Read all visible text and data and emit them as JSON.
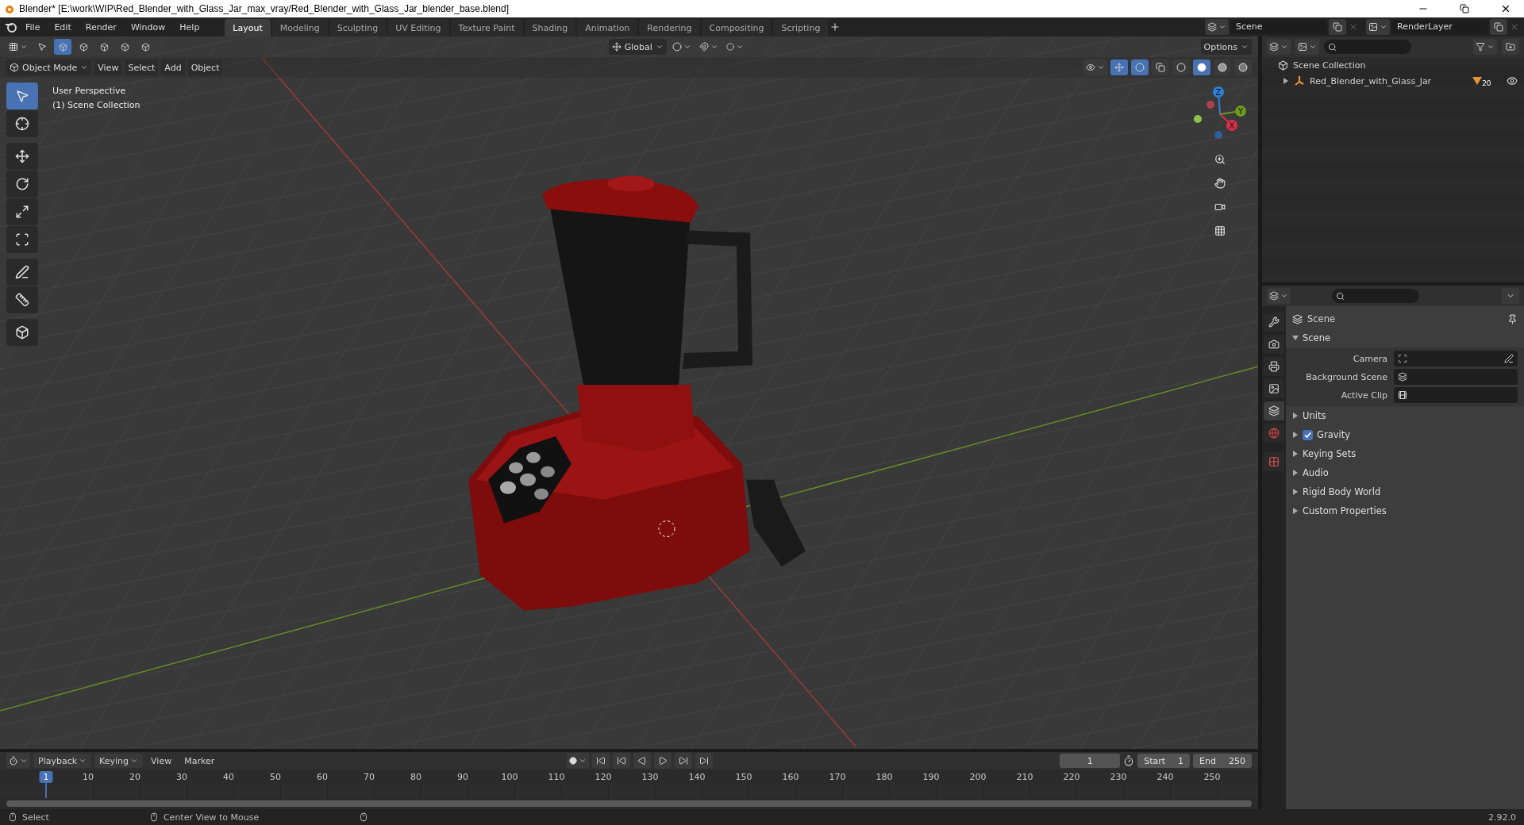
{
  "window": {
    "title": "Blender* [E:\\work\\WIP\\Red_Blender_with_Glass_Jar_max_vray/Red_Blender_with_Glass_Jar_blender_base.blend]"
  },
  "menu": [
    "File",
    "Edit",
    "Render",
    "Window",
    "Help"
  ],
  "workspaces": [
    {
      "label": "Layout",
      "selected": true
    },
    {
      "label": "Modeling",
      "selected": false
    },
    {
      "label": "Sculpting",
      "selected": false
    },
    {
      "label": "UV Editing",
      "selected": false
    },
    {
      "label": "Texture Paint",
      "selected": false
    },
    {
      "label": "Shading",
      "selected": false
    },
    {
      "label": "Animation",
      "selected": false
    },
    {
      "label": "Rendering",
      "selected": false
    },
    {
      "label": "Compositing",
      "selected": false
    },
    {
      "label": "Scripting",
      "selected": false
    }
  ],
  "scene_selector": {
    "value": "Scene"
  },
  "view_layer": {
    "value": "RenderLayer"
  },
  "viewport": {
    "select_modes": [
      {
        "selected": true
      },
      {
        "selected": false
      },
      {
        "selected": false
      },
      {
        "selected": false
      },
      {
        "selected": false
      }
    ],
    "orientation": "Global",
    "options": "Options",
    "mode": "Object Mode",
    "menus": [
      "View",
      "Select",
      "Add",
      "Object"
    ],
    "shading_modes": [
      {
        "kind": "wireframe",
        "selected": false
      },
      {
        "kind": "solid",
        "selected": true
      },
      {
        "kind": "material",
        "selected": false
      },
      {
        "kind": "rendered",
        "selected": false
      }
    ],
    "overlay_text": [
      "User Perspective",
      "(1) Scene Collection"
    ],
    "tools": [
      {
        "kind": "select",
        "selected": true
      },
      {
        "kind": "cursor",
        "selected": false
      },
      {
        "kind": "move",
        "selected": false
      },
      {
        "kind": "rotate",
        "selected": false
      },
      {
        "kind": "scale",
        "selected": false
      },
      {
        "kind": "transform",
        "selected": false
      },
      {
        "kind": "annotate",
        "selected": false
      },
      {
        "kind": "measure",
        "selected": false
      },
      {
        "kind": "add-cube",
        "selected": false
      }
    ],
    "gizmo_axes": [
      {
        "label": "Z",
        "color": "#2f7fd8"
      },
      {
        "label": "Y",
        "color": "#6f9a1f"
      },
      {
        "label": "X",
        "color": "#d9304a"
      }
    ]
  },
  "outliner": {
    "root": "Scene Collection",
    "items": [
      {
        "label": "Red_Blender_with_Glass_Jar",
        "badge": "20",
        "expanded": false
      }
    ]
  },
  "properties": {
    "tabs": [
      {
        "kind": "tool",
        "selected": false
      },
      {
        "kind": "render",
        "selected": false
      },
      {
        "kind": "output",
        "selected": false
      },
      {
        "kind": "view-layer",
        "selected": false
      },
      {
        "kind": "scene",
        "selected": true
      },
      {
        "kind": "world",
        "selected": false
      },
      {
        "kind": "texture",
        "selected": false
      }
    ],
    "header": "Scene",
    "section": {
      "title": "Scene",
      "expanded": true,
      "fields": [
        {
          "kind": "camera",
          "label": "Camera"
        },
        {
          "kind": "scene",
          "label": "Background Scene"
        },
        {
          "kind": "clip",
          "label": "Active Clip"
        }
      ]
    },
    "panels": [
      {
        "label": "Units",
        "expanded": false
      },
      {
        "label": "Gravity",
        "expanded": false,
        "checked": true
      },
      {
        "label": "Keying Sets",
        "expanded": false
      },
      {
        "label": "Audio",
        "expanded": false
      },
      {
        "label": "Rigid Body World",
        "expanded": false
      },
      {
        "label": "Custom Properties",
        "expanded": false
      }
    ]
  },
  "timeline": {
    "menus": [
      "Playback",
      "Keying",
      "View",
      "Marker"
    ],
    "current_frame": "1",
    "start_label": "Start",
    "start": "1",
    "end_label": "End",
    "end": "250",
    "ruler": [
      {
        "label": "1",
        "selected": true
      },
      {
        "label": "10",
        "selected": false
      },
      {
        "label": "20",
        "selected": false
      },
      {
        "label": "30",
        "selected": false
      },
      {
        "label": "40",
        "selected": false
      },
      {
        "label": "50",
        "selected": false
      },
      {
        "label": "60",
        "selected": false
      },
      {
        "label": "70",
        "selected": false
      },
      {
        "label": "80",
        "selected": false
      },
      {
        "label": "90",
        "selected": false
      },
      {
        "label": "100",
        "selected": false
      },
      {
        "label": "110",
        "selected": false
      },
      {
        "label": "120",
        "selected": false
      },
      {
        "label": "130",
        "selected": false
      },
      {
        "label": "140",
        "selected": false
      },
      {
        "label": "150",
        "selected": false
      },
      {
        "label": "160",
        "selected": false
      },
      {
        "label": "170",
        "selected": false
      },
      {
        "label": "180",
        "selected": false
      },
      {
        "label": "190",
        "selected": false
      },
      {
        "label": "200",
        "selected": false
      },
      {
        "label": "210",
        "selected": false
      },
      {
        "label": "220",
        "selected": false
      },
      {
        "label": "230",
        "selected": false
      },
      {
        "label": "240",
        "selected": false
      },
      {
        "label": "250",
        "selected": false
      }
    ]
  },
  "status_bar": {
    "hints": [
      "Select",
      "Center View to Mouse"
    ],
    "version": "2.92.0"
  }
}
